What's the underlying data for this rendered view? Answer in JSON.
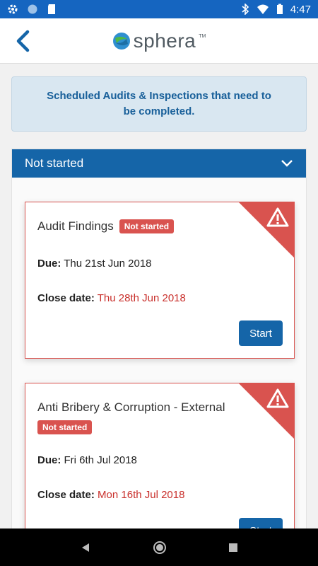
{
  "status_bar": {
    "time": "4:47"
  },
  "header": {
    "logo_text": "sphera",
    "logo_tm": "TM"
  },
  "info": {
    "text": "Scheduled Audits & Inspections that need to be completed."
  },
  "section": {
    "title": "Not started"
  },
  "cards": [
    {
      "title": "Audit Findings",
      "badge": "Not started",
      "due_label": "Due:",
      "due_value": "Thu 21st Jun 2018",
      "close_label": "Close date:",
      "close_value": "Thu 28th Jun 2018",
      "button": "Start"
    },
    {
      "title": "Anti Bribery & Corruption - External",
      "badge": "Not started",
      "due_label": "Due:",
      "due_value": "Fri 6th Jul 2018",
      "close_label": "Close date:",
      "close_value": "Mon 16th Jul 2018",
      "button": "Start"
    }
  ],
  "colors": {
    "primary": "#1565a8",
    "danger": "#d9534f",
    "status_bar": "#1565c0"
  }
}
